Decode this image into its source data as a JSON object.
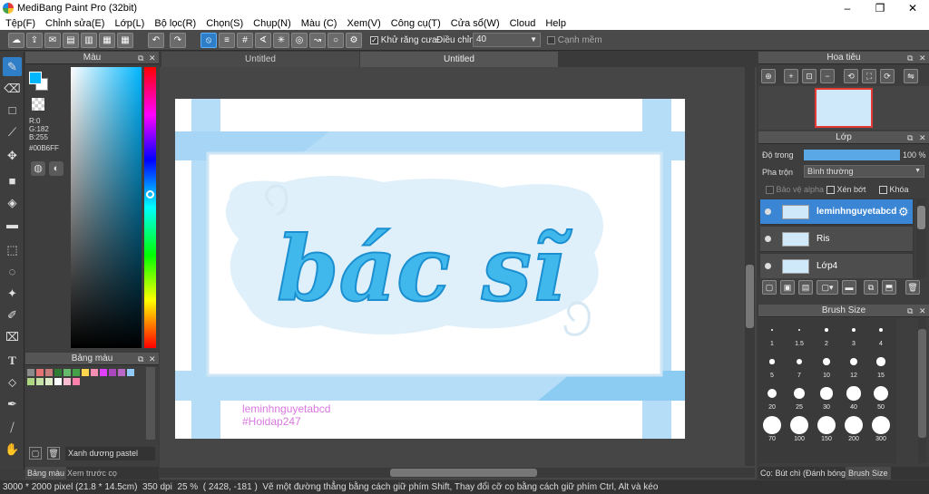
{
  "app": {
    "title": "MediBang Paint Pro (32bit)"
  },
  "window_controls": {
    "minimize": "–",
    "maximize": "❐",
    "close": "✕"
  },
  "menu": [
    "Tệp(F)",
    "Chỉnh sửa(E)",
    "Lớp(L)",
    "Bộ lọc(R)",
    "Chọn(S)",
    "Chụp(N)",
    "Màu (C)",
    "Xem(V)",
    "Công cụ(T)",
    "Cửa sổ(W)",
    "Cloud",
    "Help"
  ],
  "toolbar": {
    "antialias_label": "Khử răng cưa",
    "adjust_label": "Điều chỉnh",
    "adjust_value": "40",
    "sharp_edge_label": "Cạnh mềm"
  },
  "color_panel": {
    "title": "Màu",
    "r": "R:0",
    "g": "G:182",
    "b": "B:255",
    "hex": "#00B6FF",
    "current_color": "#00B6FF"
  },
  "palette_panel": {
    "title": "Bảng màu",
    "palette_name": "Xanh dương pastel",
    "colors": [
      "#8b8b8b",
      "#e57373",
      "#c77b7b",
      "#2e7d32",
      "#66bb6a",
      "#43a047",
      "#ffd54f",
      "#f48fb1",
      "#e040fb",
      "#ab47bc",
      "#ba68c8",
      "#90caf9",
      "#aed581",
      "#c5e1a5",
      "#dcedc8",
      "#ffffff",
      "#f8bbd0",
      "#ff80ab"
    ]
  },
  "bottom_tabs": {
    "palette": "Bảng màu",
    "brush_preview": "Xem trước cọ"
  },
  "document_tabs": [
    "Untitled",
    "Untitled"
  ],
  "artwork": {
    "title_text": "bác sĩ",
    "credit_line1": "leminhnguyetabcd",
    "credit_line2": "#Hoidap247"
  },
  "navigator": {
    "title": "Hoa tiêu"
  },
  "layer_panel": {
    "title": "Lớp",
    "opacity_label": "Độ trong",
    "opacity_value": "100 %",
    "opacity_percent": 100,
    "blend_label": "Pha trộn",
    "blend_value": "Bình thường",
    "protect_alpha": "Bảo vệ alpha",
    "clipping": "Xén bớt",
    "lock": "Khóa",
    "layers": [
      {
        "name": "leminhnguyetabcd",
        "selected": true
      },
      {
        "name": "Ris",
        "selected": false
      },
      {
        "name": "Lớp4",
        "selected": false
      }
    ]
  },
  "brush_size_panel": {
    "title": "Brush Size",
    "sizes": [
      "1",
      "1.5",
      "2",
      "3",
      "4",
      "5",
      "7",
      "10",
      "12",
      "15",
      "20",
      "25",
      "30",
      "40",
      "50",
      "70",
      "100",
      "150",
      "200",
      "300"
    ]
  },
  "right_bottom_tabs": {
    "brush_info": "Cọ: Bút chì (Đánh bóng)",
    "brush_size": "Brush Size"
  },
  "status_bar": {
    "dimensions": "3000 * 2000 pixel",
    "physical": "(21.8 * 14.5cm)",
    "dpi": "350 dpi",
    "zoom": "25 %",
    "coords": "( 2428, -181 )",
    "hint": "Vẽ một đường thẳng bằng cách giữ phím Shift, Thay đổi cỡ cọ bằng cách giữ phím Ctrl, Alt và kéo"
  }
}
